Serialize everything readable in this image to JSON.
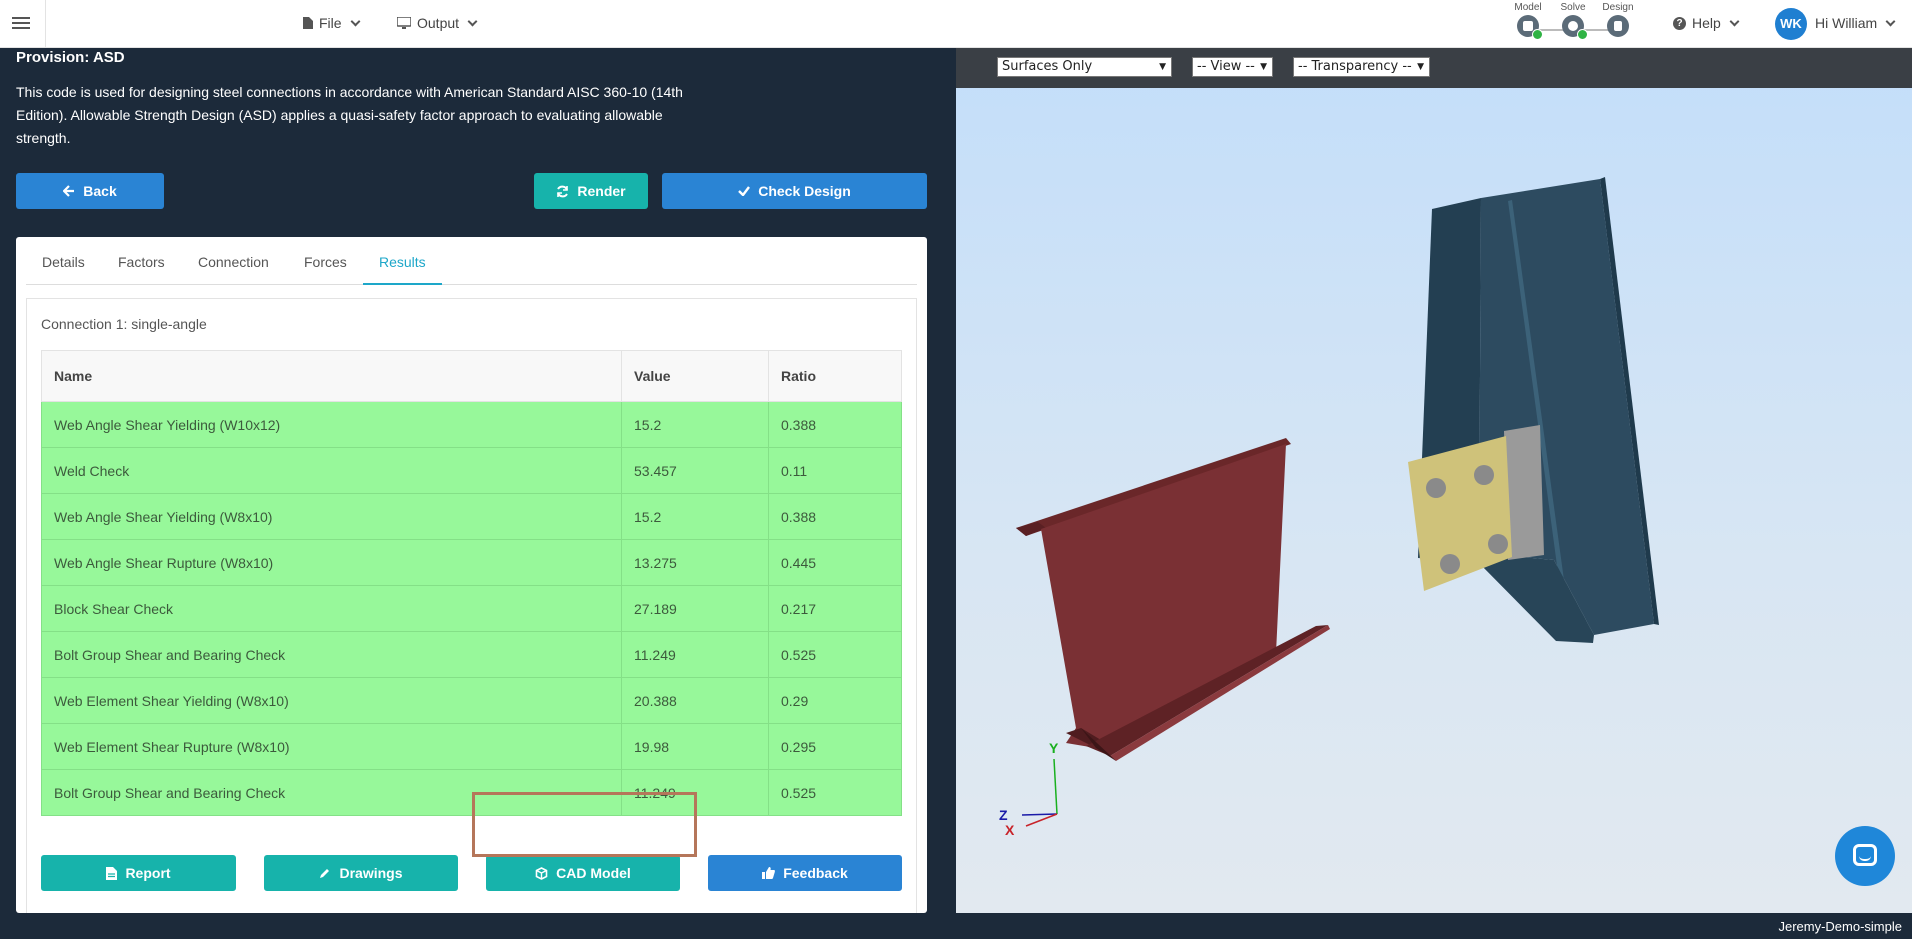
{
  "nav": {
    "file_label": "File",
    "output_label": "Output",
    "steps": [
      {
        "label": "Model"
      },
      {
        "label": "Solve"
      },
      {
        "label": "Design"
      }
    ],
    "help_label": "Help",
    "avatar_initials": "WK",
    "greeting": "Hi William"
  },
  "left": {
    "provision": "Provision: ASD",
    "description": "This code is used for designing steel connections in accordance with American Standard AISC 360-10 (14th Edition). Allowable Strength Design (ASD) applies a quasi-safety factor approach to evaluating allowable strength.",
    "back_label": "Back",
    "render_label": "Render",
    "check_design_label": "Check Design",
    "tabs": [
      "Details",
      "Factors",
      "Connection",
      "Forces",
      "Results"
    ],
    "active_tab": "Results",
    "connection_title": "Connection 1: single-angle",
    "table": {
      "headers": [
        "Name",
        "Value",
        "Ratio"
      ],
      "rows": [
        {
          "name": "Web Angle Shear Yielding (W10x12)",
          "value": "15.2",
          "ratio": "0.388"
        },
        {
          "name": "Weld Check",
          "value": "53.457",
          "ratio": "0.11"
        },
        {
          "name": "Web Angle Shear Yielding (W8x10)",
          "value": "15.2",
          "ratio": "0.388"
        },
        {
          "name": "Web Angle Shear Rupture (W8x10)",
          "value": "13.275",
          "ratio": "0.445"
        },
        {
          "name": "Block Shear Check",
          "value": "27.189",
          "ratio": "0.217"
        },
        {
          "name": "Bolt Group Shear and Bearing Check",
          "value": "11.249",
          "ratio": "0.525"
        },
        {
          "name": "Web Element Shear Yielding (W8x10)",
          "value": "20.388",
          "ratio": "0.29"
        },
        {
          "name": "Web Element Shear Rupture (W8x10)",
          "value": "19.98",
          "ratio": "0.295"
        },
        {
          "name": "Bolt Group Shear and Bearing Check",
          "value": "11.249",
          "ratio": "0.525"
        }
      ]
    },
    "report_label": "Report",
    "drawings_label": "Drawings",
    "cad_model_label": "CAD Model",
    "feedback_label": "Feedback"
  },
  "viewer": {
    "surfaces_select": "Surfaces Only",
    "view_select": "-- View --",
    "transparency_select": "-- Transparency --",
    "axes": {
      "y": "Y",
      "z": "Z",
      "x": "X"
    }
  },
  "footer": {
    "project_name": "Jeremy-Demo-simple"
  },
  "colors": {
    "success_row": "#97f89a",
    "primary": "#2a84d4",
    "teal": "#17b3ab",
    "beam": "#7a3034",
    "column": "#2c4a5e",
    "plate": "#cfc27a"
  }
}
